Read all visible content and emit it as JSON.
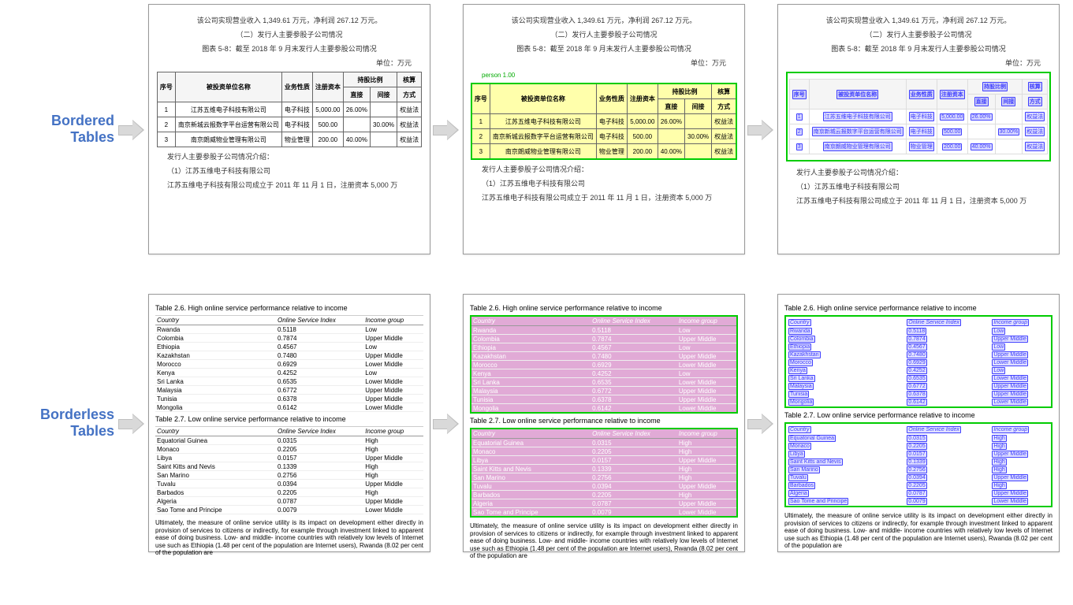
{
  "labels": {
    "bordered": "Bordered\nTables",
    "borderless": "Borderless\nTables"
  },
  "zh": {
    "line1": "该公司实现营业收入 1,349.61 万元，净利润 267.12 万元。",
    "line2": "（二）发行人主要参股子公司情况",
    "line3": "图表 5-8：截至 2018 年 9 月末发行人主要参股公司情况",
    "unit": "单位：万元",
    "line4": "发行人主要参股子公司情况介绍：",
    "line5": "（1）江苏五维电子科技有限公司",
    "line6": "江苏五维电子科技有限公司成立于 2011 年 11 月 1 日，注册资本 5,000 万",
    "seg_label": "person 1.00",
    "headers": [
      "序号",
      "被投资单位名称",
      "业务性质",
      "注册资本",
      "持股比例",
      "核算"
    ],
    "sub": [
      "直接",
      "间接",
      "方式"
    ],
    "rows": [
      [
        "1",
        "江苏五维电子科技有限公司",
        "电子科技",
        "5,000.00",
        "26.00%",
        "",
        "权益法"
      ],
      [
        "2",
        "南京新城云报数字平台运营有限公司",
        "电子科技",
        "500.00",
        "",
        "30.00%",
        "权益法"
      ],
      [
        "3",
        "南京朗威物业管理有限公司",
        "物业管理",
        "200.00",
        "40.00%",
        "",
        "权益法"
      ]
    ]
  },
  "en": {
    "title26": "Table 2.6.   High online service performance relative to income",
    "title27": "Table 2.7.   Low online service performance relative to income",
    "headers": [
      "Country",
      "Online Service Index",
      "Income group"
    ],
    "t26_rows": [
      [
        "Rwanda",
        "0.5118",
        "Low"
      ],
      [
        "Colombia",
        "0.7874",
        "Upper Middle"
      ],
      [
        "Ethiopia",
        "0.4567",
        "Low"
      ],
      [
        "Kazakhstan",
        "0.7480",
        "Upper Middle"
      ],
      [
        "Morocco",
        "0.6929",
        "Lower Middle"
      ],
      [
        "Kenya",
        "0.4252",
        "Low"
      ],
      [
        "Sri Lanka",
        "0.6535",
        "Lower Middle"
      ],
      [
        "Malaysia",
        "0.6772",
        "Upper Middle"
      ],
      [
        "Tunisia",
        "0.6378",
        "Upper Middle"
      ],
      [
        "Mongolia",
        "0.6142",
        "Lower Middle"
      ]
    ],
    "t27_rows": [
      [
        "Equatorial Guinea",
        "0.0315",
        "High"
      ],
      [
        "Monaco",
        "0.2205",
        "High"
      ],
      [
        "Libya",
        "0.0157",
        "Upper Middle"
      ],
      [
        "Saint Kitts and Nevis",
        "0.1339",
        "High"
      ],
      [
        "San Marino",
        "0.2756",
        "High"
      ],
      [
        "Tuvalu",
        "0.0394",
        "Upper Middle"
      ],
      [
        "Barbados",
        "0.2205",
        "High"
      ],
      [
        "Algeria",
        "0.0787",
        "Upper Middle"
      ],
      [
        "Sao Tome and Principe",
        "0.0079",
        "Lower Middle"
      ]
    ],
    "paragraph": "Ultimately, the measure of online service utility is its impact on development either directly in provision of services to citizens or indirectly, for example through investment linked to apparent ease of doing business. Low- and middle- income countries with relatively low levels of Internet use such as Ethiopia (1.48 per cent of the population are Internet users), Rwanda (8.02 per cent of the population are"
  }
}
